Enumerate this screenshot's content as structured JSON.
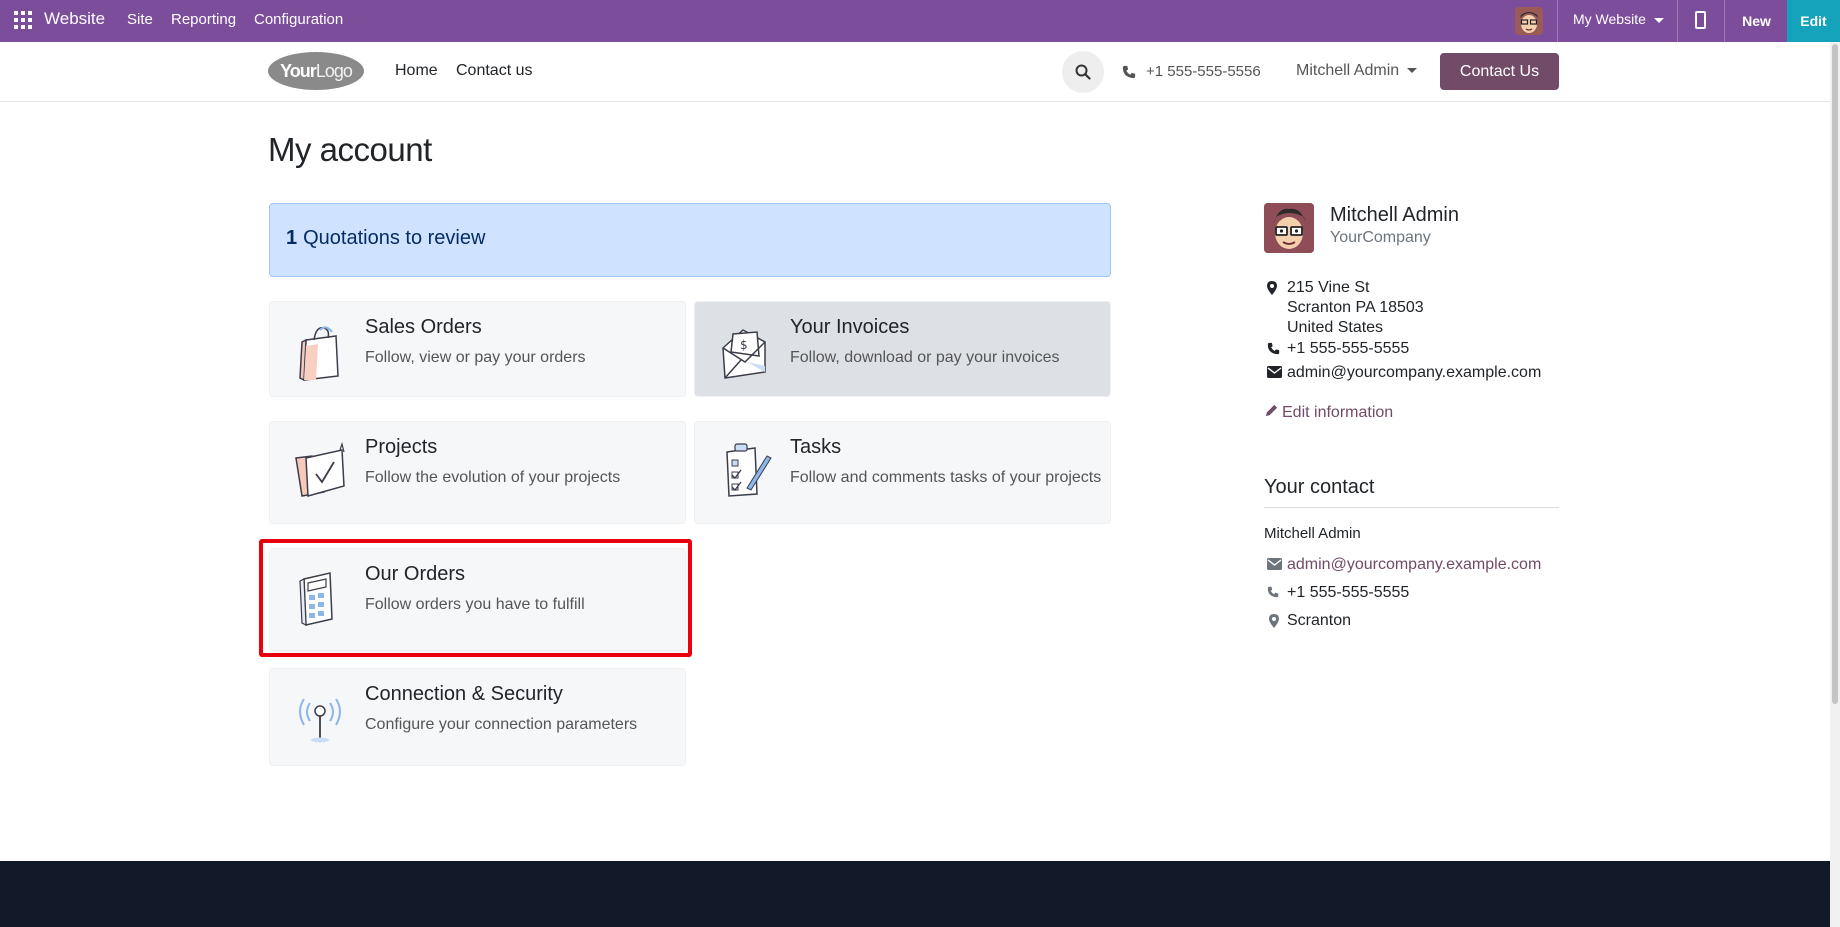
{
  "topbar": {
    "brand": "Website",
    "menus": [
      "Site",
      "Reporting",
      "Configuration"
    ],
    "website_selector": "My Website",
    "new_label": "New",
    "edit_label": "Edit",
    "bg_color": "#7c4d9b",
    "edit_color": "#15a3bb"
  },
  "header": {
    "logo": {
      "bold": "Your",
      "light": "Logo"
    },
    "nav": [
      "Home",
      "Contact us"
    ],
    "phone": "+1 555-555-5556",
    "user": "Mitchell Admin",
    "cta": "Contact Us",
    "cta_color": "#714b67"
  },
  "main": {
    "title": "My account",
    "alert": {
      "count": "1",
      "text": "Quotations to review"
    },
    "cards": [
      {
        "title": "Sales Orders",
        "desc": "Follow, view or pay your orders",
        "icon": "shopping-bag-icon"
      },
      {
        "title": "Your Invoices",
        "desc": "Follow, download or pay your invoices",
        "icon": "invoice-envelope-icon"
      },
      {
        "title": "Projects",
        "desc": "Follow the evolution of your projects",
        "icon": "folder-check-icon"
      },
      {
        "title": "Tasks",
        "desc": "Follow and comments tasks of your projects",
        "icon": "clipboard-tasks-icon"
      },
      {
        "title": "Our Orders",
        "desc": "Follow orders you have to fulfill",
        "icon": "calculator-icon"
      },
      {
        "title": "Connection & Security",
        "desc": "Configure your connection parameters",
        "icon": "antenna-signal-icon"
      }
    ]
  },
  "sidebar": {
    "name": "Mitchell Admin",
    "company": "YourCompany",
    "address": [
      "215 Vine St",
      "Scranton PA 18503",
      "United States"
    ],
    "phone": "+1 555-555-5555",
    "email": "admin@yourcompany.example.com",
    "edit_label": "Edit information",
    "contact": {
      "title": "Your contact",
      "name": "Mitchell Admin",
      "email": "admin@yourcompany.example.com",
      "phone": "+1 555-555-5555",
      "city": "Scranton"
    }
  }
}
